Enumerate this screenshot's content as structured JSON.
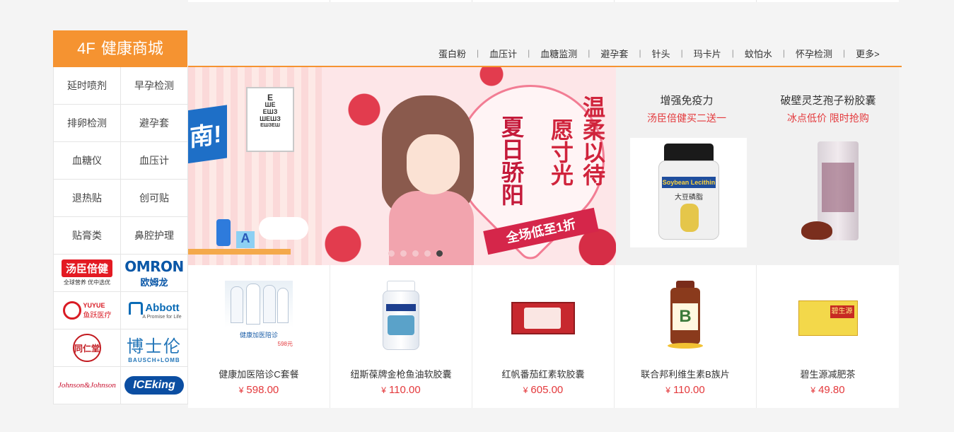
{
  "floor": {
    "number": "4F",
    "name": "健康商城"
  },
  "quick_nav": [
    "蛋白粉",
    "血压计",
    "血糖监测",
    "避孕套",
    "针头",
    "玛卡片",
    "蚊怕水",
    "怀孕检测",
    "更多>"
  ],
  "categories": [
    "延时喷剂",
    "早孕检测",
    "排卵检测",
    "避孕套",
    "血糖仪",
    "血压计",
    "退热贴",
    "创可贴",
    "贴膏类",
    "鼻腔护理"
  ],
  "brands": {
    "tch": {
      "name": "汤臣倍健",
      "tagline": "全球营养 优中选优"
    },
    "omron": {
      "name": "OMRON",
      "cn": "欧姆龙"
    },
    "yuyue": {
      "name": "YUYUE",
      "cn": "鱼跃医疗"
    },
    "abbott": {
      "name": "Abbott",
      "tagline": "A Promise for Life"
    },
    "trt": {
      "name": "同仁堂"
    },
    "bausch": {
      "name": "博士伦",
      "en": "BAUSCH+LOMB"
    },
    "jj": {
      "name": "Johnson&Johnson"
    },
    "iceking": {
      "name": "ICEking"
    }
  },
  "banner_left": {
    "headline": "南!",
    "chart_text": "E\nШЕ\nЕШЗ\nШЕШЗ\nЕШЗЕШ",
    "letter": "A"
  },
  "banner_main": {
    "col1": "夏日骄阳",
    "col2": "愿寸光",
    "col3": "温柔以待",
    "ribbon": "全场低至1折",
    "slide_count": 5,
    "active_slide": 5
  },
  "promos": [
    {
      "title": "增强免疫力",
      "subtitle": "汤臣倍健买二送一",
      "label_en": "Soybean Lecithin",
      "label_cn": "大豆磷脂"
    },
    {
      "title": "破壁灵芝孢子粉胶囊",
      "subtitle": "冰点低价 限时抢购"
    }
  ],
  "products": [
    {
      "name": "健康加医陪诊C套餐",
      "price": "598.00",
      "thumb_caption": "健康加医陪诊",
      "thumb_price": "598元"
    },
    {
      "name": "纽斯葆牌金枪鱼油软胶囊",
      "price": "110.00"
    },
    {
      "name": "红帆番茄红素软胶囊",
      "price": "605.00"
    },
    {
      "name": "联合邦利维生素B族片",
      "price": "110.00",
      "thumb_letter": "B"
    },
    {
      "name": "碧生源减肥茶",
      "price": "49.80",
      "thumb_text": "碧生源"
    }
  ],
  "currency": "¥",
  "colors": {
    "accent": "#f59331",
    "price": "#e4393c"
  }
}
